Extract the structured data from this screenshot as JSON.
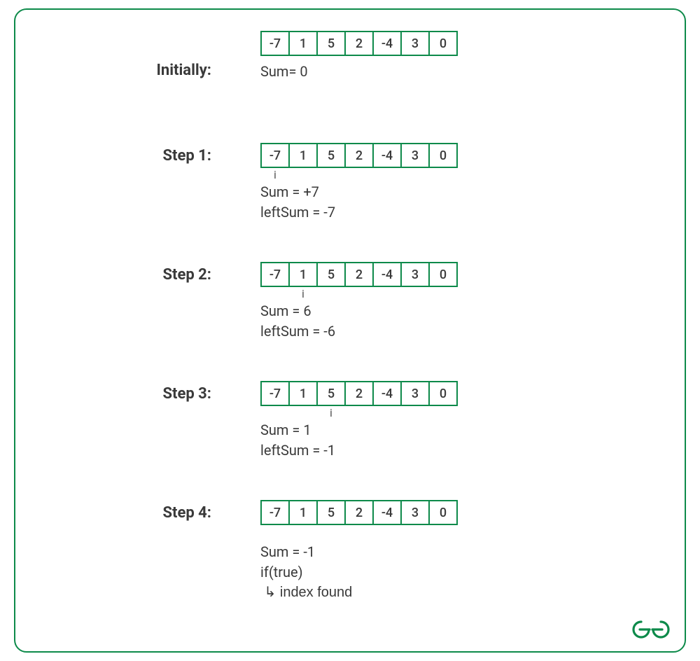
{
  "array": [
    "-7",
    "1",
    "5",
    "2",
    "-4",
    "3",
    "0"
  ],
  "initial": {
    "label": "Initially:",
    "sumLine": "Sum= 0"
  },
  "steps": [
    {
      "label": "Step 1:",
      "pointer": "i",
      "pointerIndex": 0,
      "lines": [
        "Sum = +7",
        "leftSum = -7"
      ]
    },
    {
      "label": "Step 2:",
      "pointer": "i",
      "pointerIndex": 1,
      "lines": [
        "Sum = 6",
        "leftSum = -6"
      ]
    },
    {
      "label": "Step 3:",
      "pointer": "i",
      "pointerIndex": 2,
      "lines": [
        "Sum = 1",
        "leftSum = -1"
      ]
    },
    {
      "label": "Step 4:",
      "pointer": null,
      "pointerIndex": null,
      "lines": [
        "Sum = -1",
        "if(true)",
        " ↳ index found"
      ]
    }
  ],
  "colors": {
    "border": "#0d8a4a",
    "text": "#3a3a3a"
  }
}
